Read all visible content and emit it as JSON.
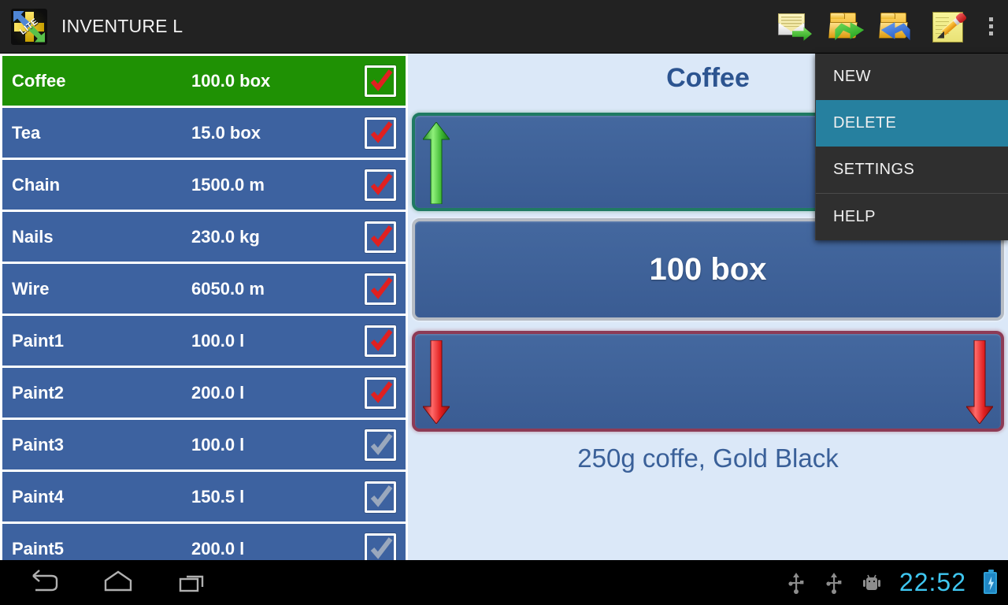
{
  "app": {
    "title": "INVENTURE L",
    "icon": "app-logo-lite-icon",
    "lite_badge": "LITE"
  },
  "toolbar": {
    "actions": [
      {
        "name": "send-mail-icon",
        "label": "Send by e-mail"
      },
      {
        "name": "export-icon",
        "label": "Export"
      },
      {
        "name": "import-icon",
        "label": "Import"
      },
      {
        "name": "edit-icon",
        "label": "Edit"
      }
    ],
    "overflow_label": "More options"
  },
  "menu": {
    "items": [
      {
        "label": "NEW",
        "active": false
      },
      {
        "label": "DELETE",
        "active": true
      },
      {
        "label": "SETTINGS",
        "active": false
      },
      {
        "label": "HELP",
        "active": false
      }
    ],
    "highlight_color": "#26809f"
  },
  "list": {
    "selected_color": "#1f9104",
    "row_color": "#3d62a0",
    "rows": [
      {
        "name": "Coffee",
        "qty": "100.0 box",
        "checked": true,
        "selected": true
      },
      {
        "name": "Tea",
        "qty": "15.0 box",
        "checked": true,
        "selected": false
      },
      {
        "name": "Chain",
        "qty": "1500.0 m",
        "checked": true,
        "selected": false
      },
      {
        "name": "Nails",
        "qty": "230.0 kg",
        "checked": true,
        "selected": false
      },
      {
        "name": "Wire",
        "qty": "6050.0 m",
        "checked": true,
        "selected": false
      },
      {
        "name": "Paint1",
        "qty": "100.0 l",
        "checked": true,
        "selected": false
      },
      {
        "name": "Paint2",
        "qty": "200.0 l",
        "checked": true,
        "selected": false
      },
      {
        "name": "Paint3",
        "qty": "100.0 l",
        "checked": false,
        "selected": false
      },
      {
        "name": "Paint4",
        "qty": "150.5 l",
        "checked": false,
        "selected": false
      },
      {
        "name": "Paint5",
        "qty": "200.0 l",
        "checked": false,
        "selected": false
      }
    ]
  },
  "detail": {
    "title": "Coffee",
    "quantity": "100 box",
    "description": "250g coffe, Gold Black",
    "add_panel": {
      "name": "increase-panel",
      "arrow": "arrow-up-green-icon",
      "color": "#1f7a62"
    },
    "remove_panel": {
      "name": "decrease-panel",
      "arrow": "arrow-down-red-icon",
      "color": "#8d3b56"
    },
    "background": "#dbe8f8",
    "title_color": "#2c5490"
  },
  "system": {
    "nav": [
      {
        "name": "back-icon",
        "label": "Back"
      },
      {
        "name": "home-icon",
        "label": "Home"
      },
      {
        "name": "recents-icon",
        "label": "Recent apps"
      }
    ],
    "status_icons": [
      {
        "name": "usb-icon",
        "label": "USB connected"
      },
      {
        "name": "usb-debug-icon",
        "label": "USB debugging"
      },
      {
        "name": "android-debug-icon",
        "label": "Android debug"
      }
    ],
    "time": "22:52",
    "battery": {
      "name": "battery-charging-icon",
      "label": "Charging"
    },
    "clock_color": "#3fc6f0"
  }
}
